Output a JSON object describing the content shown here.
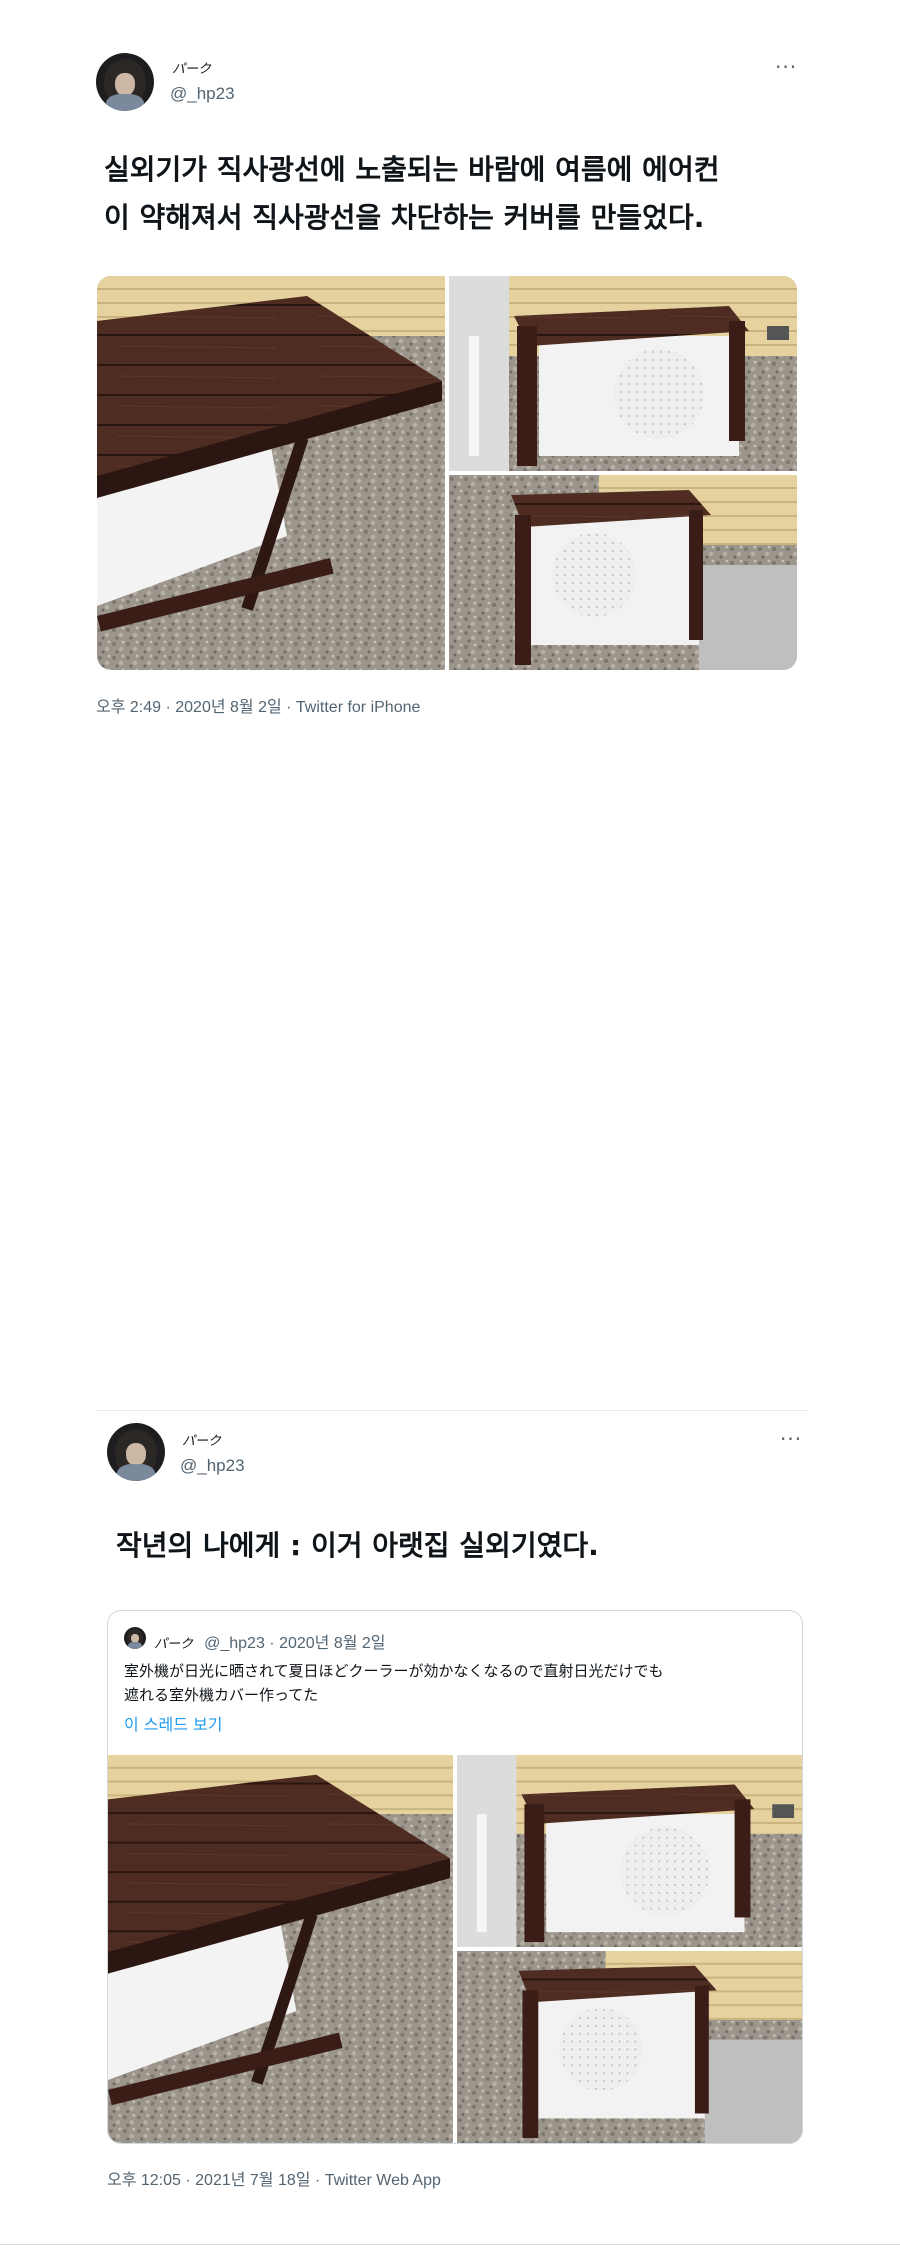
{
  "tweet1": {
    "author_name": "パーク",
    "author_handle": "@_hp23",
    "more": "···",
    "text_line1": "실외기가 직사광선에 노출되는 바람에 여름에 에어컨",
    "text_line2": "이 약해져서 직사광선을 차단하는 커버를 만들었다.",
    "timestamp": "오후 2:49 · 2020년 8월 2일 · Twitter for iPhone",
    "photos": [
      "outdoor-unit-cover-photo-1",
      "outdoor-unit-cover-photo-2",
      "outdoor-unit-cover-photo-3"
    ]
  },
  "tweet2": {
    "author_name": "パーク",
    "author_handle": "@_hp23",
    "more": "···",
    "text": "작년의 나에게 : 이거 아랫집 실외기였다.",
    "timestamp": "오후 12:05 · 2021년 7월 18일 · Twitter Web App",
    "quote": {
      "author_name": "パーク",
      "meta": "@_hp23 · 2020년 8월 2일",
      "text_line1": "室外機が日光に晒されて夏日ほどクーラーが効かなくなるので直射日光だけでも",
      "text_line2": "遮れる室外機カバー作ってた",
      "thread_link": "이 스레드 보기",
      "photos": [
        "outdoor-unit-cover-photo-1",
        "outdoor-unit-cover-photo-2",
        "outdoor-unit-cover-photo-3"
      ]
    }
  },
  "colors": {
    "text": "#0f1419",
    "secondary": "#536471",
    "link": "#1d9bf0",
    "border": "#cfd9de",
    "wood": "#4a2a22",
    "siding": "#e3cf9a",
    "gravel": "#9a928a",
    "ac_unit": "#f2f2f2"
  }
}
